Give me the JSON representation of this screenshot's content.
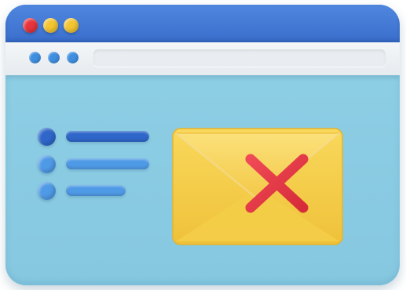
{
  "window": {
    "title_dots": [
      "red",
      "yellow",
      "yellow"
    ],
    "nav_dots": 3
  },
  "content": {
    "list_items": 3
  },
  "icons": {
    "envelope": "envelope-icon",
    "error": "x-mark-icon"
  },
  "colors": {
    "titlebar": "#3a6fcc",
    "toolbar": "#eef1f4",
    "background": "#8fd0e6",
    "envelope": "#f6cf45",
    "error": "#e33a45",
    "list_primary": "#2f66c9",
    "list_secondary": "#4f9ae6"
  }
}
